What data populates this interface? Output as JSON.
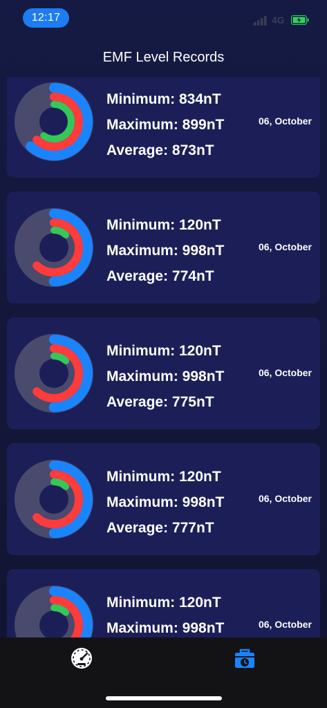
{
  "status_bar": {
    "time": "12:17",
    "network": "4G",
    "accent_color": "#1d7cf2",
    "battery_color": "#30d158"
  },
  "header": {
    "title": "EMF Level Records"
  },
  "colors": {
    "ring_track": "#4a4a6c",
    "ring_outer": "#1a84ff",
    "ring_middle": "#ff3b3b",
    "ring_inner": "#34c759",
    "card_bg": "#1c1f57"
  },
  "records": [
    {
      "minimum": "Minimum: 834nT",
      "maximum": "Maximum: 899nT",
      "average": "Average: 873nT",
      "date": "06, October",
      "ring_outer": 0.62,
      "ring_middle": 0.62,
      "ring_inner": 0.6
    },
    {
      "minimum": "Minimum: 120nT",
      "maximum": "Maximum: 998nT",
      "average": "Average: 774nT",
      "date": "06, October",
      "ring_outer": 0.5,
      "ring_middle": 0.62,
      "ring_inner": 0.12
    },
    {
      "minimum": "Minimum: 120nT",
      "maximum": "Maximum: 998nT",
      "average": "Average: 775nT",
      "date": "06, October",
      "ring_outer": 0.5,
      "ring_middle": 0.62,
      "ring_inner": 0.12
    },
    {
      "minimum": "Minimum: 120nT",
      "maximum": "Maximum: 998nT",
      "average": "Average: 777nT",
      "date": "06, October",
      "ring_outer": 0.5,
      "ring_middle": 0.62,
      "ring_inner": 0.12
    },
    {
      "minimum": "Minimum: 120nT",
      "maximum": "Maximum: 998nT",
      "average": "",
      "date": "06, October",
      "ring_outer": 0.5,
      "ring_middle": 0.62,
      "ring_inner": 0.12
    }
  ],
  "tab_bar": {
    "items": [
      {
        "icon": "gauge-icon",
        "active": false
      },
      {
        "icon": "records-icon",
        "active": true
      }
    ],
    "active_color": "#1a84ff"
  }
}
